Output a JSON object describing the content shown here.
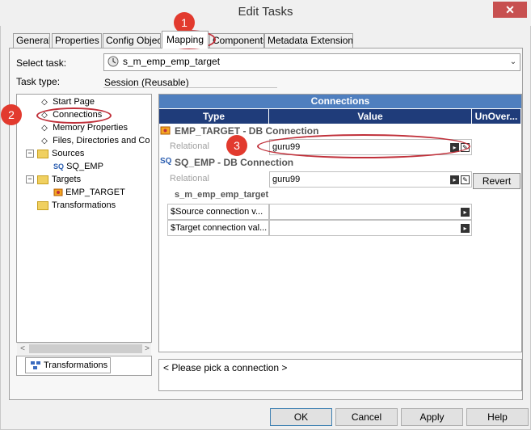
{
  "window": {
    "title": "Edit Tasks",
    "close_glyph": "✕"
  },
  "tabs": [
    {
      "label": "General"
    },
    {
      "label": "Properties"
    },
    {
      "label": "Config Object"
    },
    {
      "label": "Mapping"
    },
    {
      "label": "Components"
    },
    {
      "label": "Metadata Extensions"
    }
  ],
  "active_tab": "Mapping",
  "select_task": {
    "label": "Select task:",
    "value": "s_m_emp_emp_target",
    "icon": "session-icon",
    "arrow_glyph": "⌄"
  },
  "task_type": {
    "label": "Task type:",
    "value": "Session (Reusable)"
  },
  "tree": {
    "items": [
      {
        "label": "Start Page",
        "icon": "diamond-icon"
      },
      {
        "label": "Connections",
        "icon": "diamond-icon"
      },
      {
        "label": "Memory Properties",
        "icon": "diamond-icon"
      },
      {
        "label": "Files, Directories and Commands",
        "icon": "diamond-icon"
      },
      {
        "label": "Sources",
        "icon": "folder-icon",
        "expander": "−"
      },
      {
        "label": "SQ_EMP",
        "icon": "sq-icon",
        "prefix": "SQ"
      },
      {
        "label": "Targets",
        "icon": "folder-icon",
        "expander": "−"
      },
      {
        "label": "EMP_TARGET",
        "icon": "target-icon"
      },
      {
        "label": "Transformations",
        "icon": "folder-icon"
      }
    ],
    "scroll_left_glyph": "<",
    "scroll_right_glyph": ">",
    "bottom_tab": "Transformations"
  },
  "grid": {
    "title": "Connections",
    "headers": [
      "Type",
      "Value",
      "UnOver..."
    ],
    "sections": [
      {
        "title": "EMP_TARGET - DB Connection",
        "type": "Relational",
        "value": "guru99",
        "override": ""
      },
      {
        "title": "SQ_EMP - DB Connection",
        "type": "Relational",
        "value": "guru99",
        "override": "Revert",
        "prefix": "SQ"
      }
    ],
    "group_title": "s_m_emp_emp_target",
    "param_rows": [
      {
        "label": "$Source connection v...",
        "value": ""
      },
      {
        "label": "$Target connection val...",
        "value": ""
      }
    ],
    "message": "< Please pick a connection >"
  },
  "buttons": {
    "ok": "OK",
    "cancel": "Cancel",
    "apply": "Apply",
    "help": "Help"
  },
  "callouts": [
    "1",
    "2",
    "3"
  ],
  "colors": {
    "grid_title_bg": "#4f7fbf",
    "grid_header_bg": "#1f3c7a",
    "callout_red": "#e23a2e",
    "close_red": "#c75050"
  }
}
